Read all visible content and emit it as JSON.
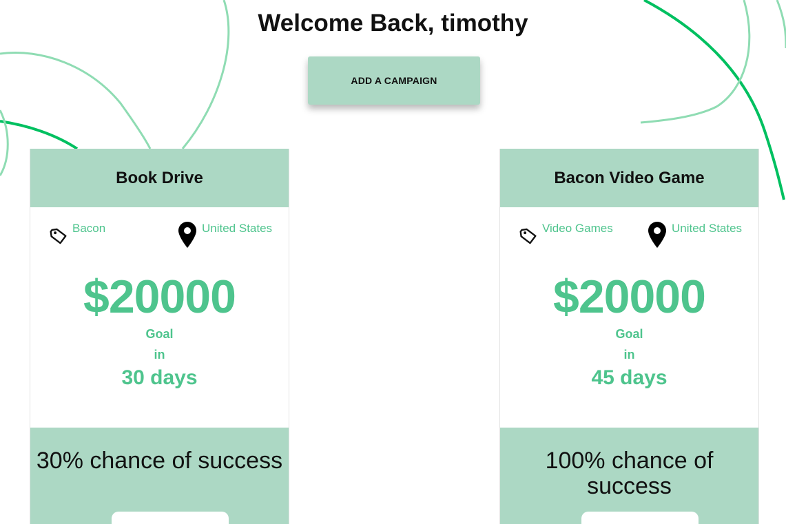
{
  "header": {
    "welcome": "Welcome Back, timothy",
    "add_campaign_label": "ADD A CAMPAIGN"
  },
  "colors": {
    "accent": "#4ec48d",
    "card_band": "#acd8c4",
    "decor_line": "#00c060"
  },
  "campaigns": [
    {
      "title": "Book Drive",
      "category": "Bacon",
      "category_icon": "tag-icon",
      "location": "United States",
      "location_icon": "map-pin-icon",
      "amount": "$20000",
      "goal_label": "Goal",
      "in_label": "in",
      "duration": "30 days",
      "chance": "30% chance of success"
    },
    {
      "title": "Bacon Video Game",
      "category": "Video Games",
      "category_icon": "tag-icon",
      "location": "United States",
      "location_icon": "map-pin-icon",
      "amount": "$20000",
      "goal_label": "Goal",
      "in_label": "in",
      "duration": "45 days",
      "chance": "100% chance of success"
    }
  ]
}
